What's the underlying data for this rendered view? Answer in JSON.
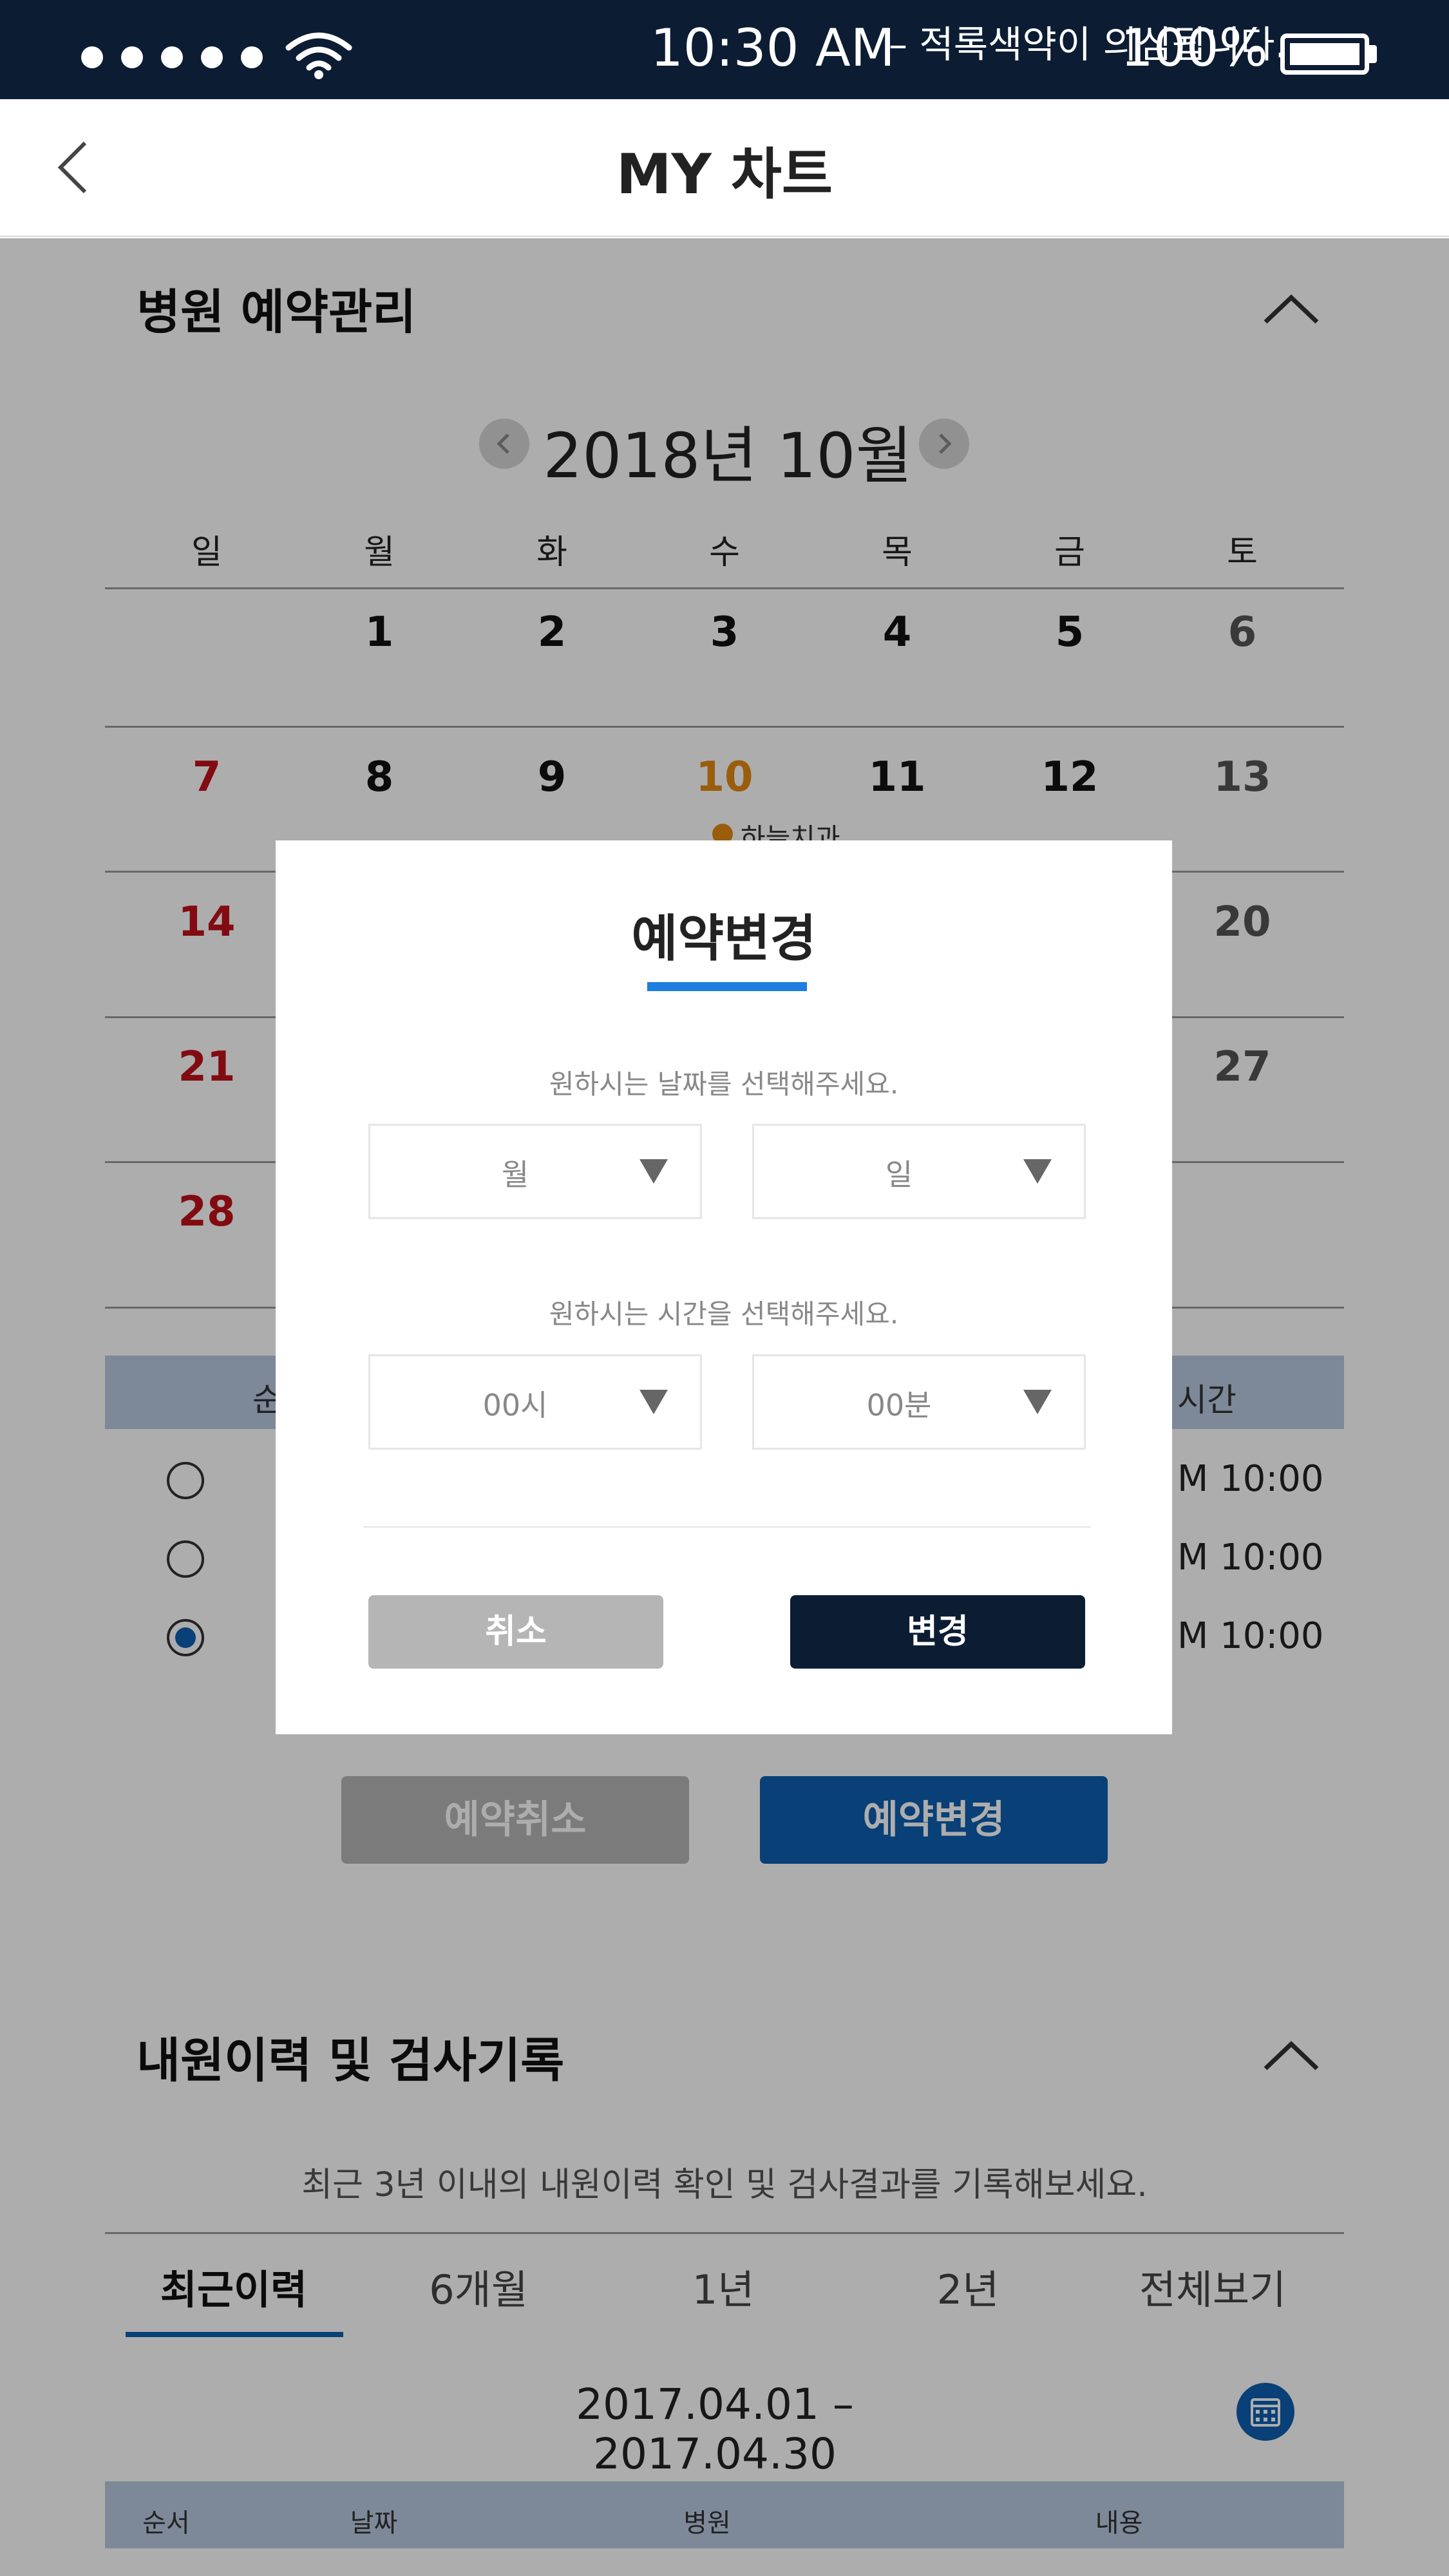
{
  "status_bar": {
    "time": "10:30 AM",
    "battery": "100%",
    "note_text": "– 적록색약이 의심됩니다.",
    "signal_icon": "signal-dots-icon",
    "wifi_icon": "wifi-icon",
    "battery_icon": "battery-icon"
  },
  "header": {
    "title": "MY 차트",
    "back_icon": "chevron-left-icon"
  },
  "reservation": {
    "section_title": "병원 예약관리",
    "collapse_icon": "chevron-up-icon",
    "calendar": {
      "month_label": "2018년 10월",
      "weekdays": [
        "일",
        "월",
        "화",
        "수",
        "목",
        "금",
        "토"
      ],
      "weeks": [
        [
          "",
          "1",
          "2",
          "3",
          "4",
          "5",
          "6"
        ],
        [
          "7",
          "8",
          "9",
          "10",
          "11",
          "12",
          "13"
        ],
        [
          "14",
          "",
          "",
          "",
          "",
          "",
          "20"
        ],
        [
          "21",
          "",
          "",
          "",
          "",
          "",
          "27"
        ],
        [
          "28",
          "",
          "",
          "",
          "",
          "",
          ""
        ]
      ],
      "today": "10",
      "today_event": "하늘치과"
    },
    "table": {
      "header_left": "순",
      "header_right": "시간",
      "rows": [
        {
          "time": "M 10:00",
          "selected": false
        },
        {
          "time": "M 10:00",
          "selected": false
        },
        {
          "time": "M 10:00",
          "selected": true
        }
      ]
    },
    "cancel_button": "예약취소",
    "change_button": "예약변경"
  },
  "history": {
    "section_title": "내원이력 및 검사기록",
    "collapse_icon": "chevron-up-icon",
    "description": "최근 3년 이내의 내원이력 확인 및 검사결과를 기록해보세요.",
    "tabs": [
      "최근이력",
      "6개월",
      "1년",
      "2년",
      "전체보기"
    ],
    "active_tab": "최근이력",
    "date_range": "2017.04.01 – 2017.04.30",
    "calendar_icon": "calendar-icon",
    "table_headers": [
      "순서",
      "날짜",
      "병원",
      "내용"
    ]
  },
  "modal": {
    "title": "예약변경",
    "date_hint": "원하시는 날짜를 선택해주세요.",
    "month_select": "월",
    "day_select": "일",
    "time_hint": "원하시는 시간을 선택해주세요.",
    "hour_select": "00시",
    "minute_select": "00분",
    "cancel_label": "취소",
    "confirm_label": "변경"
  },
  "colors": {
    "status_bar_bg": "#0c1c33",
    "accent_blue": "#0d5fb0",
    "today_orange": "#e48a13",
    "sunday_red": "#c0111a",
    "confirm_dark": "#0c1c33",
    "cancel_gray": "#b5b5b5"
  }
}
